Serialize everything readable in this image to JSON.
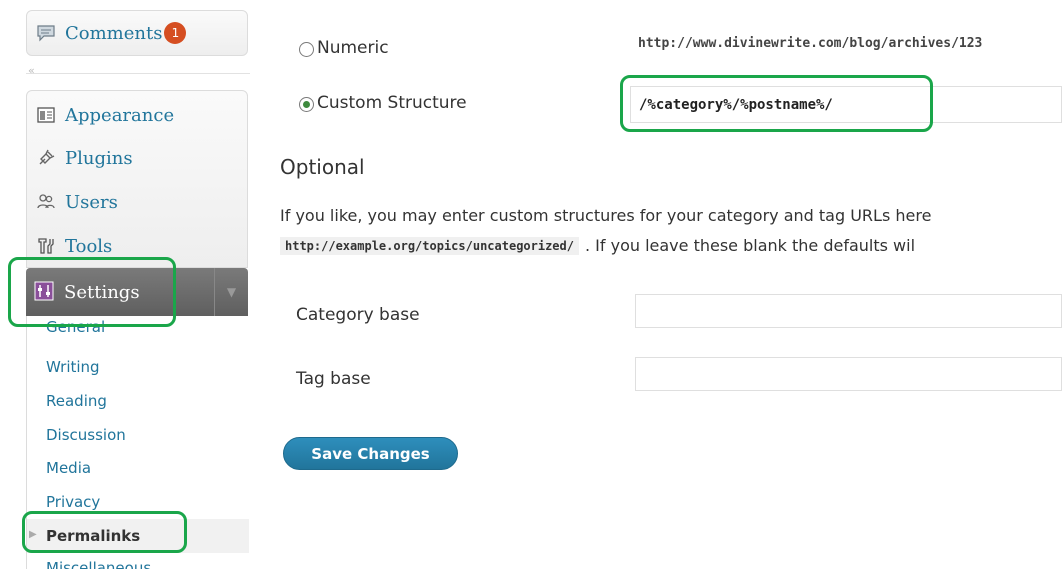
{
  "sidebar": {
    "comments": {
      "label": "Comments",
      "badge": "1"
    },
    "collapse_glyph": "«",
    "items": [
      {
        "label": "Appearance",
        "icon": "appearance-icon"
      },
      {
        "label": "Plugins",
        "icon": "plugins-icon"
      },
      {
        "label": "Users",
        "icon": "users-icon"
      },
      {
        "label": "Tools",
        "icon": "tools-icon"
      }
    ],
    "settings": {
      "label": "Settings",
      "icon": "settings-icon",
      "toggle": "▼"
    },
    "submenu": [
      "General",
      "Writing",
      "Reading",
      "Discussion",
      "Media",
      "Privacy",
      "Permalinks",
      "Miscellaneous"
    ]
  },
  "main": {
    "numeric": {
      "label": "Numeric",
      "example": "http://www.divinewrite.com/blog/archives/123"
    },
    "custom": {
      "label": "Custom Structure",
      "value": "/%category%/%postname%/"
    },
    "optional_heading": "Optional",
    "description_line1": "If you like, you may enter custom structures for your category and tag URLs here",
    "example_url": "http://example.org/topics/uncategorized/",
    "description_line2": ". If you leave these blank the defaults wil",
    "category_base_label": "Category base",
    "tag_base_label": "Tag base",
    "save_label": "Save Changes"
  },
  "colors": {
    "link": "#21759b",
    "highlight": "#1aa64a",
    "badge": "#d54e21",
    "button": "#21759b"
  }
}
